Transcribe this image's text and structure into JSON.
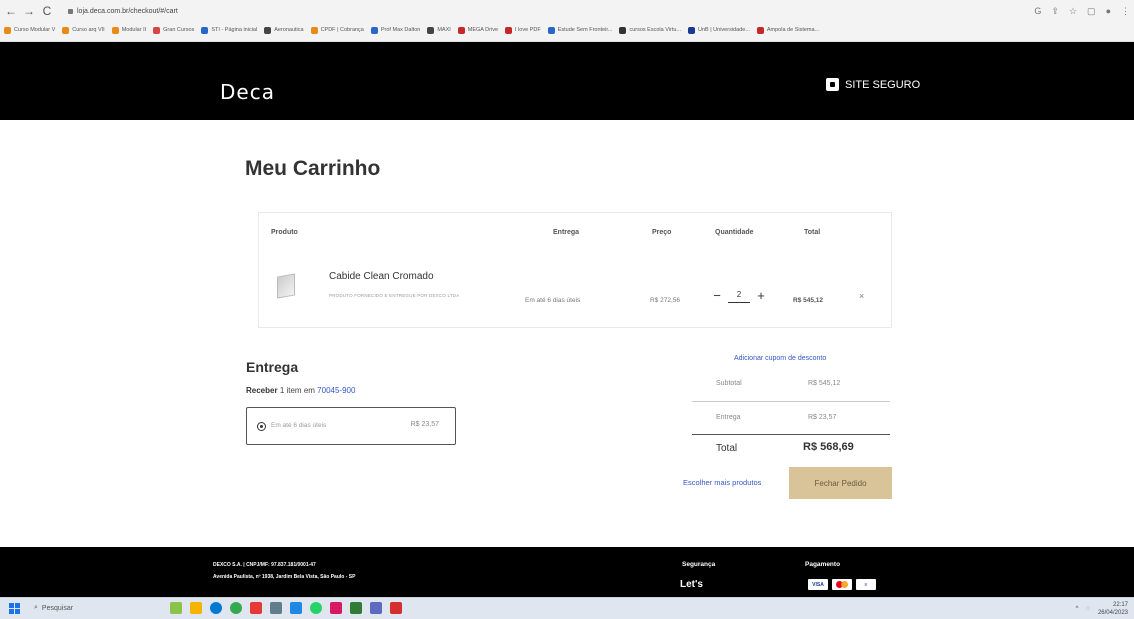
{
  "browser": {
    "url": "loja.deca.com.br/checkout/#/cart",
    "bookmarks": [
      "Curso Modular V",
      "Curso arq VII",
      "Modular II",
      "Gran Cursos",
      "STI - Página inicial",
      "Aeronautica",
      "CPDF | Cobrança",
      "Prof Max Dalton",
      "MAXI",
      "MEGA Drive",
      "I love PDF",
      "Estude Sem Fronteir...",
      "cursos Escola Virtu...",
      "UnB | Universidade...",
      "Ampola de Sistema..."
    ],
    "bookmark_colors": [
      "#e98a15",
      "#e98a15",
      "#e98a15",
      "#d64545",
      "#2a66c9",
      "#444444",
      "#e98a15",
      "#2a66c9",
      "#444444",
      "#c62828",
      "#c62828",
      "#2a66c9",
      "#333333",
      "#1a3a8f",
      "#c62828"
    ]
  },
  "header": {
    "logo": "Deca",
    "secure_label": "SITE SEGURO"
  },
  "cart": {
    "title": "Meu Carrinho",
    "columns": {
      "product": "Produto",
      "delivery": "Entrega",
      "price": "Preço",
      "quantity": "Quantidade",
      "total": "Total"
    },
    "item": {
      "name": "Cabide Clean Cromado",
      "note": "PRODUTO FORNECIDO E ENTREGUE POR DEXCO LTDA",
      "delivery": "Em até 6 dias úteis",
      "price": "R$ 272,56",
      "quantity": "2",
      "total": "R$ 545,12",
      "remove": "×",
      "minus": "−",
      "plus": "+"
    }
  },
  "delivery": {
    "title": "Entrega",
    "receive_label": "Receber",
    "receive_text": "1 item em",
    "zip": "70045-900",
    "option_label": "Em até 6 dias úteis",
    "option_price": "R$ 23,57"
  },
  "summary": {
    "coupon": "Adicionar cupom de desconto",
    "subtotal_label": "Subtotal",
    "subtotal_value": "R$ 545,12",
    "shipping_label": "Entrega",
    "shipping_value": "R$ 23,57",
    "total_label": "Total",
    "total_value": "R$ 568,69",
    "continue_shopping": "Escolher mais produtos",
    "checkout": "Fechar Pedido"
  },
  "footer": {
    "company": "DEXCO S.A. | CNPJ/MF: 97.837.181/0001-47",
    "address": "Avenida Paulista, nº 1938, Jardim Bela Vista, São Paulo - SP",
    "security_title": "Segurança",
    "payment_title": "Pagamento",
    "security_seal": "Let's",
    "card_visa": "VISA"
  },
  "taskbar": {
    "search_placeholder": "Pesquisar",
    "time": "22:17",
    "date": "26/04/2023"
  }
}
